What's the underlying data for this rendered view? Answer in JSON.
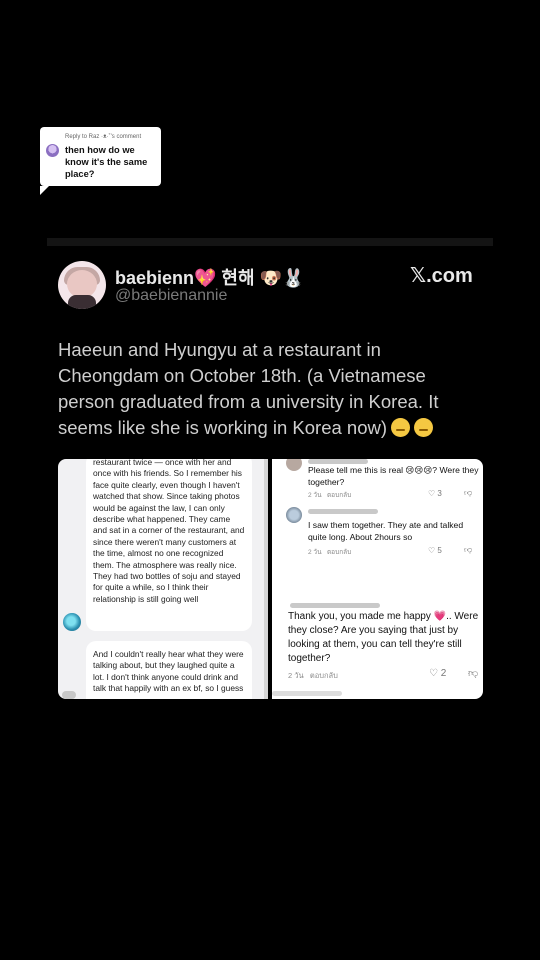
{
  "reply_bubble": {
    "header": "Reply to Raz ·ᴥ·˚'s comment",
    "text": "then how do we know it's the same place?"
  },
  "tweet": {
    "display_name": "baebienn💖 현해 🐶🐰",
    "handle": "@baebienannie",
    "brand": "𝕏.com",
    "text": "Haeeun and Hyungyu at a restaurant in Cheongdam on October 18th. (a Vietnamese person graduated from a university in Korea. It seems like she is working in Korea now)"
  },
  "left_panel": {
    "bubble1": "restaurant twice — once with her and once with his friends. So I remember his face quite clearly, even though I haven't watched that show. Since taking photos would be against the law, I can only describe what happened. They came and sat in a corner of the restaurant, and since there weren't many customers at the time, almost no one recognized them. The atmosphere was really nice. They had two bottles of soju and stayed for quite a while, so I think their relationship is still going well",
    "bubble2": "And I couldn't really hear what they were talking about, but they laughed quite a lot. I don't think anyone could drink and talk that happily with an ex bf, so I guess"
  },
  "right_panel": {
    "comments": [
      {
        "text": "Please tell me this is real 😢😢😢? Were they together?",
        "time": "2 วัน",
        "reply": "ตอบกลับ",
        "likes": "3"
      },
      {
        "text": "I saw them together. They ate and talked quite long. About 2hours so",
        "time": "2 วัน",
        "reply": "ตอบกลับ",
        "likes": "5"
      },
      {
        "text": "Thank you, you made me happy 💗.. Were they close? Are you saying that just by looking at them, you can tell they're still together?",
        "time": "2 วัน",
        "reply": "ตอบกลับ",
        "likes": "2"
      }
    ]
  },
  "colors": {
    "background": "#000000",
    "bubble": "#ffffff",
    "heart": "#e0457b"
  }
}
